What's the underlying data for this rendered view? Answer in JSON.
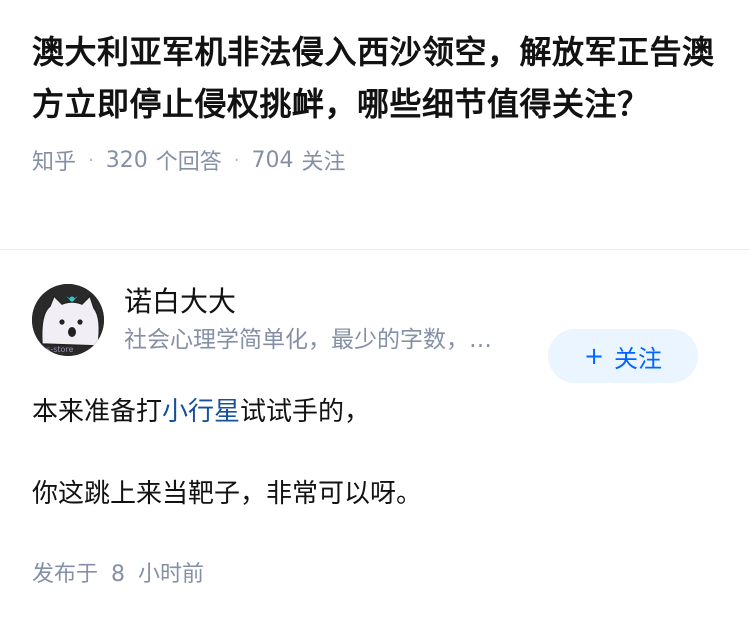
{
  "question": {
    "title": "澳大利亚军机非法侵入西沙领空，解放军正告澳方立即停止侵权挑衅，哪些细节值得关注？",
    "meta": {
      "site": "知乎",
      "answer_count": "320",
      "answer_label": "个回答",
      "follow_count": "704",
      "follow_label": "关注"
    }
  },
  "answer": {
    "author": {
      "name": "诺白大大",
      "bio": "社会心理学简单化，最少的字数，…",
      "avatar_icon": "avatar-cartoon-icon"
    },
    "follow_button": {
      "plus": "+",
      "label": "关注"
    },
    "content": {
      "line1_before": "本来准备打",
      "line1_link": "小行星",
      "line1_after": "试试手的，",
      "line2": "你这跳上来当靶子，非常可以呀。"
    },
    "published": {
      "prefix": "发布于",
      "value": "8",
      "unit": "小时前"
    }
  },
  "colors": {
    "link": "#175199",
    "meta": "#8590a6",
    "follow_bg": "#ebf5ff",
    "follow_text": "#0066ff"
  }
}
